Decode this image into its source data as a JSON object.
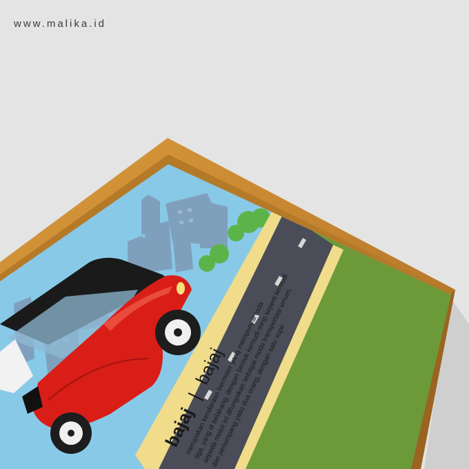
{
  "site_url": "www.malika.id",
  "poster": {
    "title_bold": "bajaj",
    "separator": "|",
    "title_light": "bajaj",
    "description_lines": [
      "merupakan kendaraan bermotor yang mempunyai roda",
      "tiga, yang di belakang, dengan bentuk kemudi mirip seperti kemudi",
      "sepeda motor ini difungsikan sebagai moda transportasi umum,",
      "dan penumpang yaitu dua orang, dengan satu sopir."
    ]
  },
  "colors": {
    "background": "#e4e4e4",
    "frame_wood": "#c9892f",
    "sky": "#88c9e8",
    "city": "#7fa0bd",
    "road": "#4a4c57",
    "road_edge": "#f0dc8a",
    "grass_panel": "#6c9a38",
    "bajaj_body": "#d81e17",
    "bajaj_roof": "#1a1a1a",
    "tree": "#5cb34a"
  }
}
